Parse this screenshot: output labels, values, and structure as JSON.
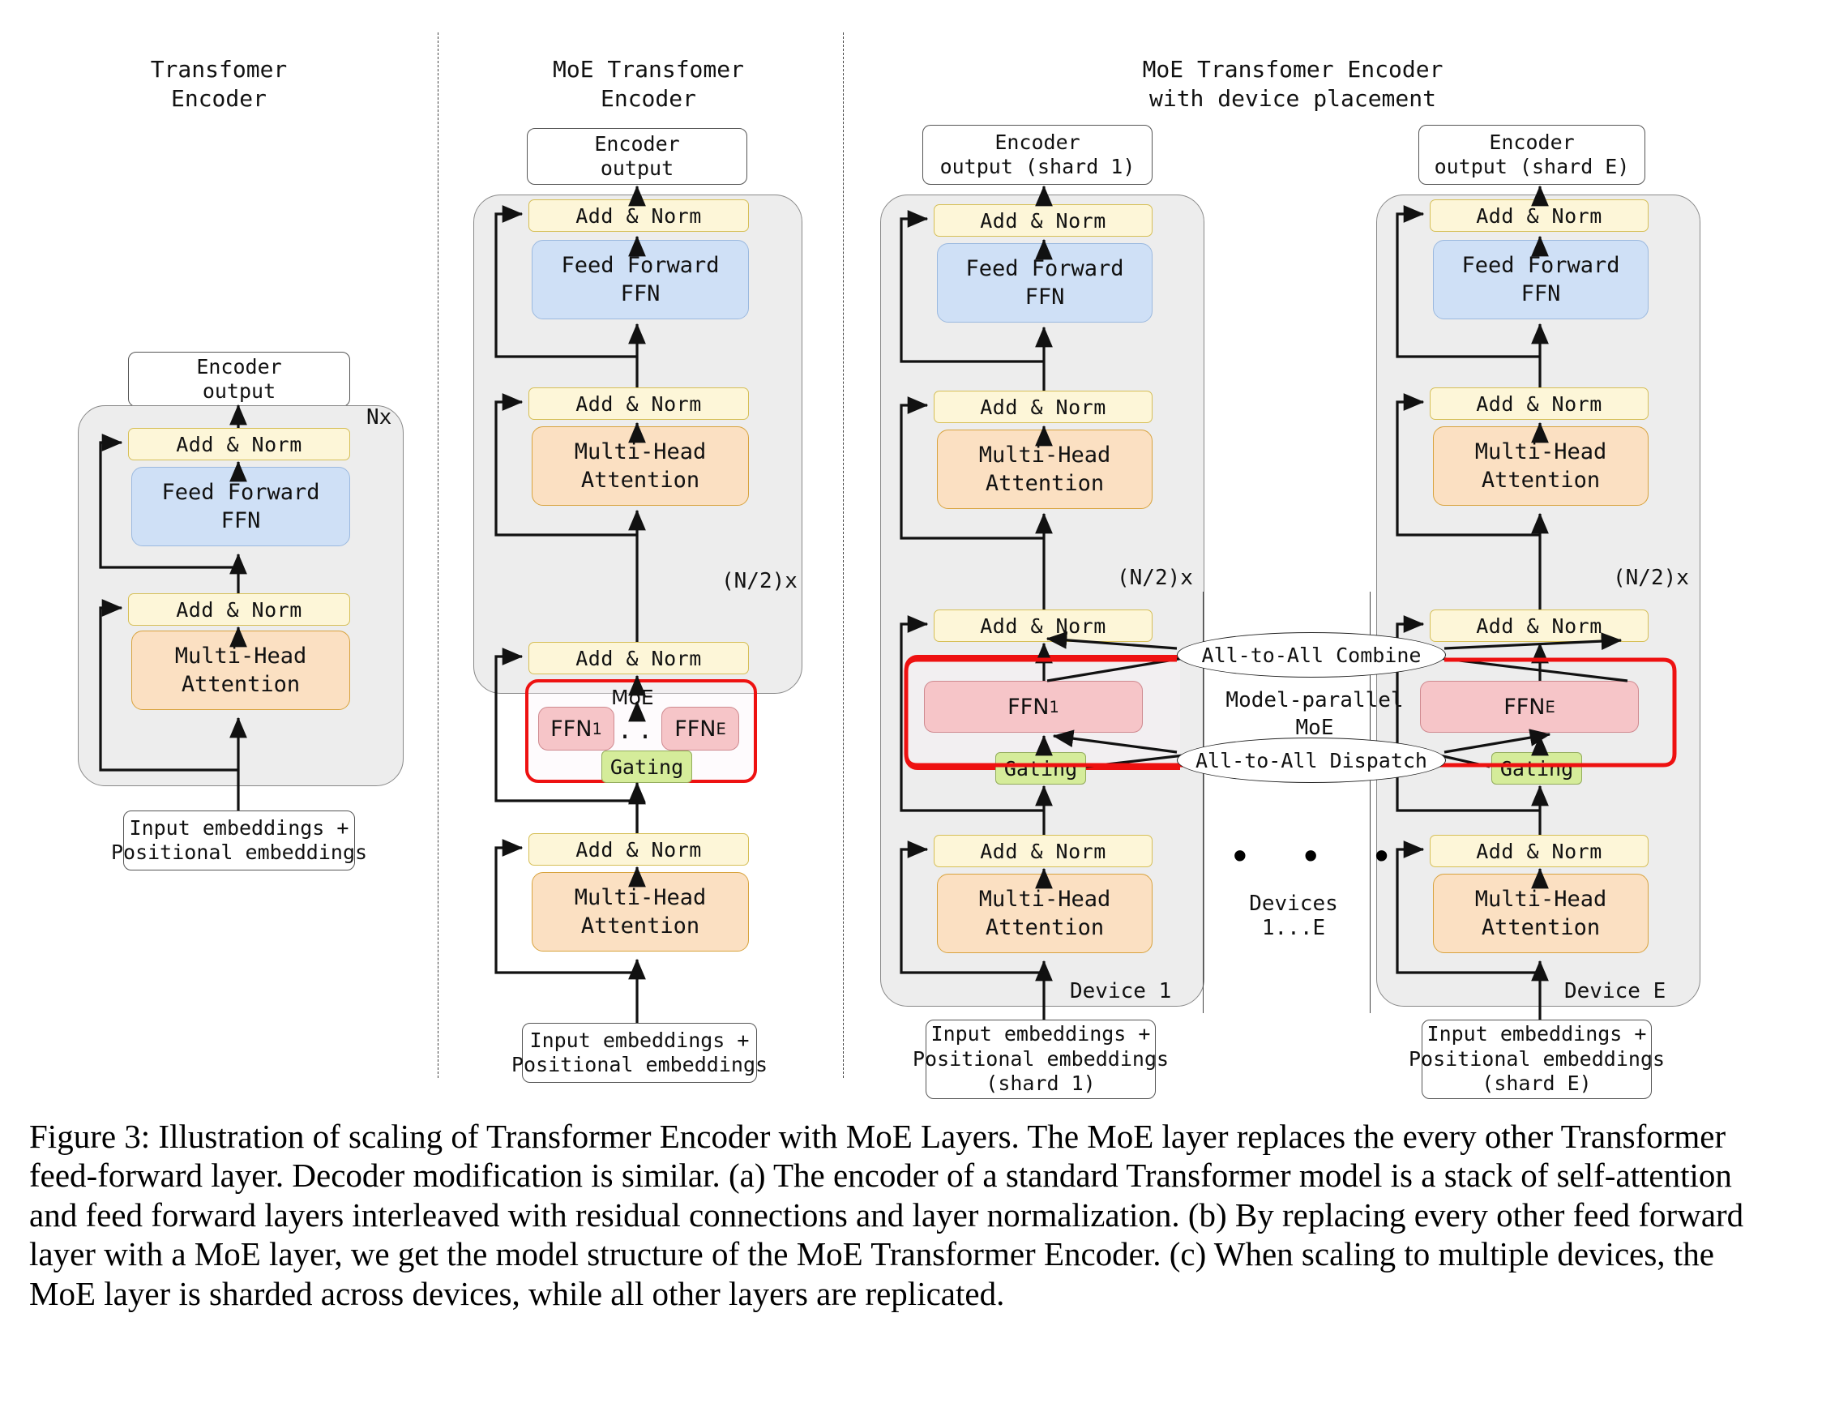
{
  "titles": {
    "a": "Transfomer\nEncoder",
    "b": "MoE Transfomer\nEncoder",
    "c": "MoE Transfomer Encoder\nwith device placement"
  },
  "labels": {
    "add_norm": "Add & Norm",
    "feed_forward": "Feed Forward\nFFN",
    "multi_head": "Multi-Head\nAttention",
    "encoder_output": "Encoder\noutput",
    "encoder_output_shard1": "Encoder\noutput (shard 1)",
    "encoder_output_shardE": "Encoder\noutput (shard E)",
    "input_embeddings": "Input embeddings +\nPositional embeddings",
    "input_embeddings_shard1": "Input embeddings +\nPositional embeddings\n(shard 1)",
    "input_embeddings_shardE": "Input embeddings +\nPositional embeddings\n(shard E)",
    "moe": "MoE",
    "gating": "Gating",
    "ffn_1": "FFN",
    "ffn_1_sub": "1",
    "ffn_E": "FFN",
    "ffn_E_sub": "E",
    "ellipsis": "...",
    "repeat_nx": "Nx",
    "repeat_half_n": "(N/2)x",
    "device_1": "Device 1",
    "device_E": "Device E",
    "devices_range": "Devices\n1...E",
    "all_to_all_combine": "All-to-All Combine",
    "all_to_all_dispatch": "All-to-All Dispatch",
    "model_parallel_moe": "Model-parallel\nMoE",
    "big_dots": "• • •"
  },
  "colors": {
    "panel_bg": "#ededed",
    "add_norm": "#fdf6d8",
    "feed_forward": "#cfe0f6",
    "multi_head": "#fbe0c2",
    "expert": "#f6c5c8",
    "gating": "#d5ec9a",
    "moe_outline": "#ee1111"
  },
  "caption": "Figure 3: Illustration of scaling of Transformer Encoder with MoE Layers. The MoE layer replaces the every other Transformer feed-forward layer. Decoder modification is similar. (a) The encoder of a standard Transformer model is a stack of self-attention and feed forward layers interleaved with residual connections and layer normalization. (b) By replacing every other feed forward layer with a MoE layer, we get the model structure of the MoE Transformer Encoder.  (c) When scaling to multiple devices, the MoE layer is sharded across devices, while all other layers are replicated."
}
